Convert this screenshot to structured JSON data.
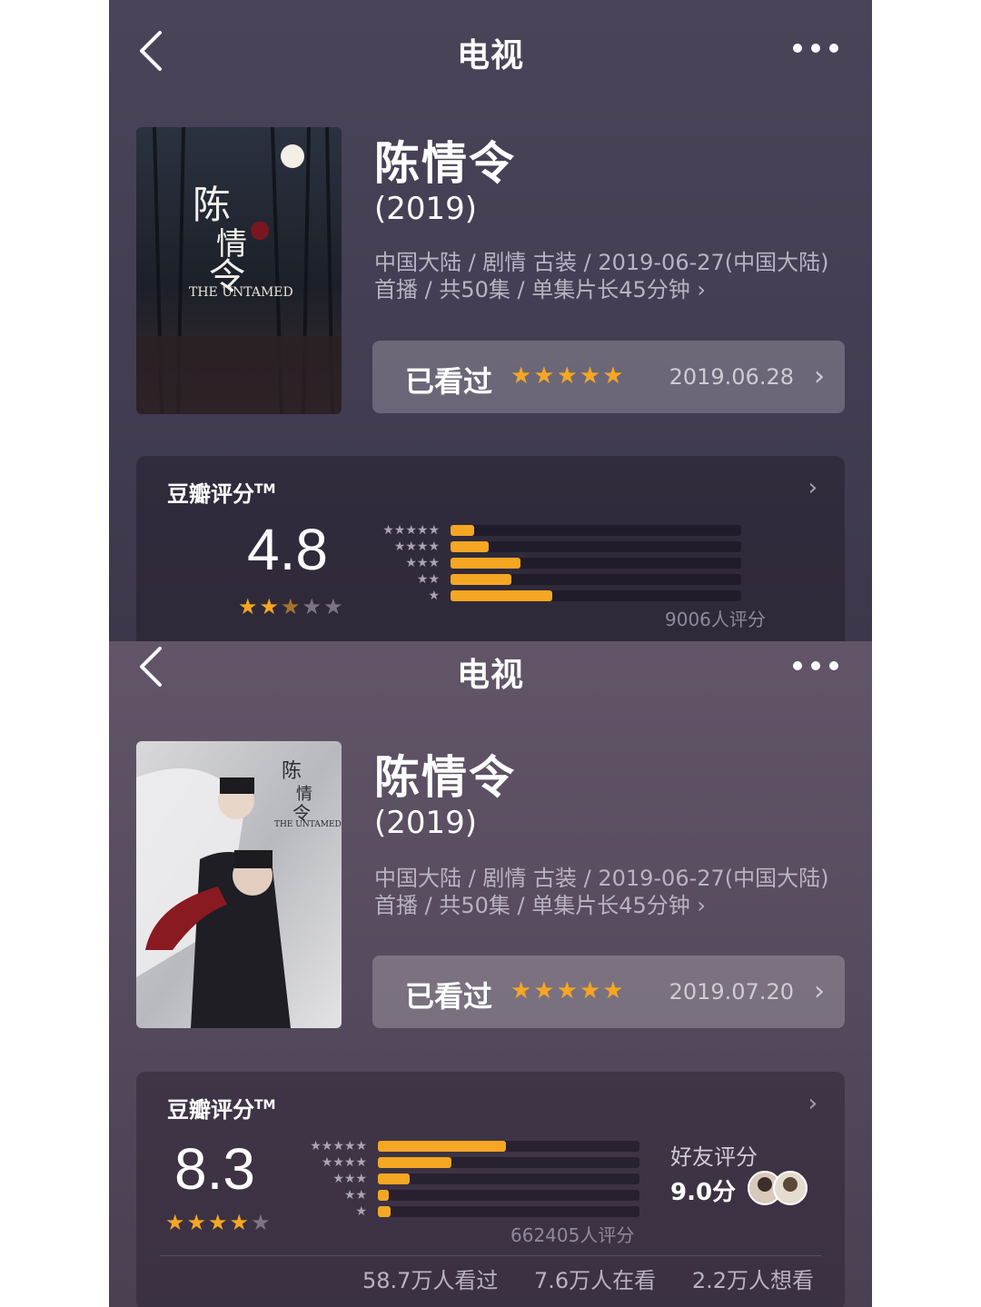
{
  "screens": [
    {
      "nav": {
        "back_icon": "chevron-left-icon",
        "title": "电视",
        "more_icon": "more-dots-icon"
      },
      "poster": {
        "overlay_text": "THE UNTAMED"
      },
      "movie": {
        "title": "陈情令",
        "year": "(2019)",
        "meta_line1": "中国大陆 / 剧情 古装 / 2019-06-27(中国大陆)",
        "meta_line2": "首播 / 共50集 / 单集片长45分钟 ›"
      },
      "watched": {
        "label": "已看过",
        "stars": "★★★★★",
        "date": "2019.06.28",
        "arrow": "›"
      },
      "rating": {
        "header": "豆瓣评分",
        "trademark": "TM",
        "arrow": "›",
        "score": "4.8",
        "score_stars": 2.5,
        "distribution": [
          0.08,
          0.13,
          0.24,
          0.21,
          0.35
        ],
        "row_stars": [
          "★★★★★",
          "★★★★",
          "★★★",
          "★★",
          "★"
        ],
        "count": "9006人评分"
      }
    },
    {
      "nav": {
        "back_icon": "chevron-left-icon",
        "title": "电视",
        "more_icon": "more-dots-icon"
      },
      "poster": {
        "overlay_text": "THE UNTAMED"
      },
      "movie": {
        "title": "陈情令",
        "year": "(2019)",
        "meta_line1": "中国大陆 / 剧情 古装 / 2019-06-27(中国大陆)",
        "meta_line2": "首播 / 共50集 / 单集片长45分钟 ›"
      },
      "watched": {
        "label": "已看过",
        "stars": "★★★★★",
        "date": "2019.07.20",
        "arrow": "›"
      },
      "rating": {
        "header": "豆瓣评分",
        "trademark": "TM",
        "arrow": "›",
        "score": "8.3",
        "score_stars": 4,
        "distribution": [
          0.49,
          0.28,
          0.12,
          0.04,
          0.05
        ],
        "row_stars": [
          "★★★★★",
          "★★★★",
          "★★★",
          "★★",
          "★"
        ],
        "count": "662405人评分",
        "friends_label": "好友评分",
        "friends_score": "9.0分",
        "stats": [
          "58.7万人看过",
          "7.6万人在看",
          "2.2万人想看"
        ]
      }
    }
  ],
  "colors": {
    "accent": "#f5a623",
    "panel1_bg": "#4a4459",
    "panel2_bg": "#5e5266"
  }
}
